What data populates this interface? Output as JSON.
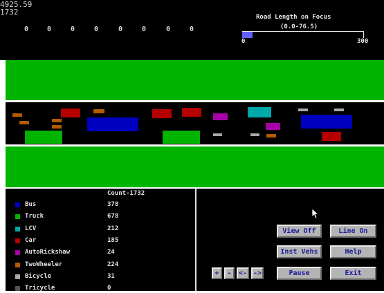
{
  "time_readout": "4925.59",
  "count_readout": "1732",
  "counters": [
    "0",
    "0",
    "0",
    "0",
    "0",
    "0",
    "0",
    "0"
  ],
  "focus": {
    "title": "Road Length on Focus",
    "range": "(0.0-76.5)",
    "min_label": "0",
    "max_label": "300",
    "fraction": 0.085
  },
  "legend": {
    "header": "Count-1732",
    "items": [
      {
        "label": "Bus",
        "count": "378",
        "color": "#0000c0"
      },
      {
        "label": "Truck",
        "count": "678",
        "color": "#00b400"
      },
      {
        "label": "LCV",
        "count": "212",
        "color": "#00a8a8"
      },
      {
        "label": "Car",
        "count": "185",
        "color": "#b40000"
      },
      {
        "label": "AutoRickshaw",
        "count": "24",
        "color": "#a800a8"
      },
      {
        "label": "TwoWheeler",
        "count": "224",
        "color": "#b45a00"
      },
      {
        "label": "Bicycle",
        "count": "31",
        "color": "#a8a8a8"
      },
      {
        "label": "Tricycle",
        "count": "0",
        "color": "#545454"
      }
    ]
  },
  "buttons": {
    "view_off": "View Off",
    "line_on": "Line On",
    "inst_vehs": "Inst Vehs",
    "help": "Help",
    "plus": "+",
    "minus": "-",
    "left": "<-",
    "right": "->",
    "pause": "Pause",
    "exit": "Exit"
  },
  "colors": {
    "grass": "#00b400",
    "road": "#000000",
    "button_face": "#b4b4b4",
    "button_text": "#1a1a9a",
    "focus_bar": "#6060ff"
  }
}
